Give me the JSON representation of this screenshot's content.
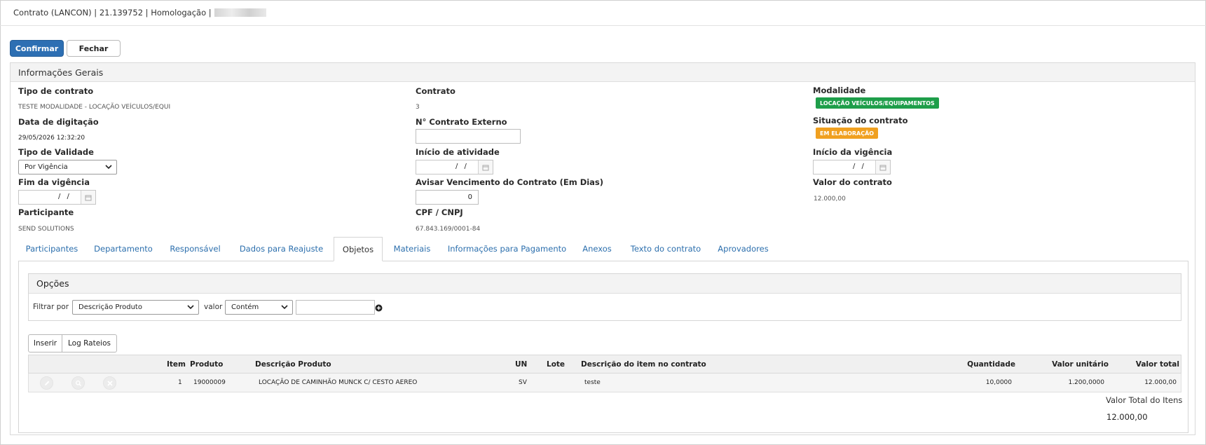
{
  "header": {
    "title": "Contrato (LANCON) | 21.139752 | Homologação |"
  },
  "toolbar": {
    "confirm_label": "Confirmar",
    "close_label": "Fechar"
  },
  "general": {
    "heading": "Informações Gerais",
    "tipo_contrato_label": "Tipo de contrato",
    "tipo_contrato_value": "TESTE MODALIDADE - LOCAÇÃO VEÍCULOS/EQUI",
    "data_digitacao_label": "Data de digitação",
    "data_digitacao_value": "29/05/2026 12:32:20",
    "tipo_validade_label": "Tipo de Validade",
    "tipo_validade_value": "Por Vigência",
    "fim_vigencia_label": "Fim da vigência",
    "fim_vigencia_value": "/ /",
    "participante_label": "Participante",
    "participante_value": "SEND SOLUTIONS",
    "contrato_label": "Contrato",
    "contrato_value": "3",
    "contrato_externo_label": "N° Contrato Externo",
    "contrato_externo_value": "",
    "inicio_atividade_label": "Início de atividade",
    "inicio_atividade_value": "/ /",
    "avisar_label": "Avisar Vencimento do Contrato (Em Dias)",
    "avisar_value": "0",
    "cpf_cnpj_label": "CPF / CNPJ",
    "cpf_cnpj_value": "67.843.169/0001-84",
    "modalidade_label": "Modalidade",
    "modalidade_value": "LOCAÇÃO VEÍCULOS/EQUIPAMENTOS",
    "situacao_label": "Situação do contrato",
    "situacao_value": "EM ELABORAÇÃO",
    "inicio_vigencia_label": "Início da vigência",
    "inicio_vigencia_value": "/ /",
    "valor_contrato_label": "Valor do contrato",
    "valor_contrato_value": "12.000,00"
  },
  "tabs": [
    {
      "label": "Participantes"
    },
    {
      "label": "Departamento"
    },
    {
      "label": "Responsável"
    },
    {
      "label": "Dados para Reajuste"
    },
    {
      "label": "Objetos"
    },
    {
      "label": "Materiais"
    },
    {
      "label": "Informações para Pagamento"
    },
    {
      "label": "Anexos"
    },
    {
      "label": "Texto do contrato"
    },
    {
      "label": "Aprovadores"
    }
  ],
  "active_tab": "Objetos",
  "options": {
    "heading": "Opções",
    "filter_label": "Filtrar por",
    "filter_value": "Descrição Produto",
    "valor_label": "valor",
    "operator_value": "Contém",
    "search_value": ""
  },
  "actions": {
    "insert_label": "Inserir",
    "log_label": "Log Rateios"
  },
  "table": {
    "headers": [
      "Item",
      "Produto",
      "Descrição Produto",
      "UN",
      "Lote",
      "Descrição do item no contrato",
      "Quantidade",
      "Valor unitário",
      "Valor total"
    ],
    "rows": [
      [
        "1",
        "19000009",
        "LOCAÇÃO DE CAMINHÃO MUNCK C/ CESTO AEREO",
        "SV",
        "",
        "teste",
        "10,0000",
        "1.200,0000",
        "12.000,00"
      ]
    ]
  },
  "totals": {
    "label": "Valor Total do Itens",
    "value": "12.000,00"
  },
  "colors": {
    "primary": "#2d6fb3",
    "link": "#2c6fad",
    "badge_green": "#1e9e4a",
    "badge_orange": "#f0a020"
  }
}
